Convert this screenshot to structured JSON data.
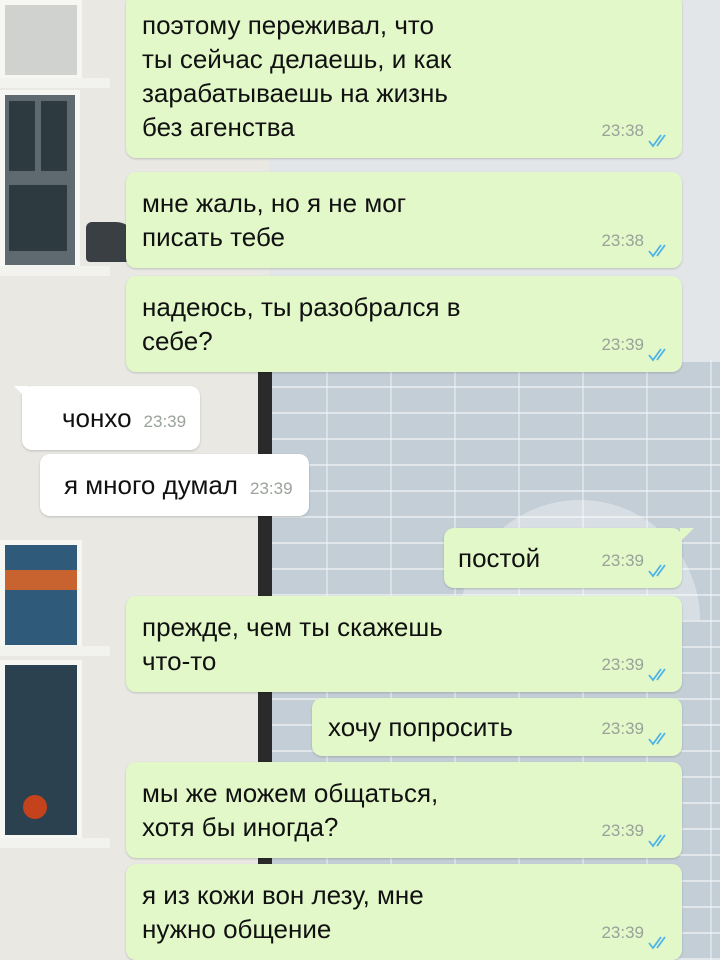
{
  "chat": {
    "messages": [
      {
        "direction": "out",
        "text": "поэтому переживал, что\nты сейчас делаешь, и как\nзарабатываешь на жизнь\nбез агенства",
        "time": "23:38",
        "status": "read"
      },
      {
        "direction": "out",
        "text": "мне жаль, но я не мог\nписать тебе",
        "time": "23:38",
        "status": "read"
      },
      {
        "direction": "out",
        "text": "надеюсь, ты разобрался в\nсебе?",
        "time": "23:39",
        "status": "read"
      },
      {
        "direction": "in",
        "text": "чонхо",
        "time": "23:39"
      },
      {
        "direction": "in",
        "text": "я много думал",
        "time": "23:39"
      },
      {
        "direction": "out",
        "text": "постой",
        "time": "23:39",
        "status": "read"
      },
      {
        "direction": "out",
        "text": "прежде, чем ты скажешь\nчто-то",
        "time": "23:39",
        "status": "read"
      },
      {
        "direction": "out",
        "text": "хочу попросить",
        "time": "23:39",
        "status": "read"
      },
      {
        "direction": "out",
        "text": "мы же можем общаться,\nхотя бы иногда?",
        "time": "23:39",
        "status": "read"
      },
      {
        "direction": "out",
        "text": "я из кожи вон лезу, мне\nнужно общение",
        "time": "23:39",
        "status": "read"
      }
    ]
  },
  "colors": {
    "outgoing_bubble": "#e2f8c9",
    "incoming_bubble": "#ffffff",
    "read_ticks": "#4fb3e8",
    "timestamp": "#9aa29a"
  },
  "icons": {
    "read_status": "double-check-icon"
  }
}
